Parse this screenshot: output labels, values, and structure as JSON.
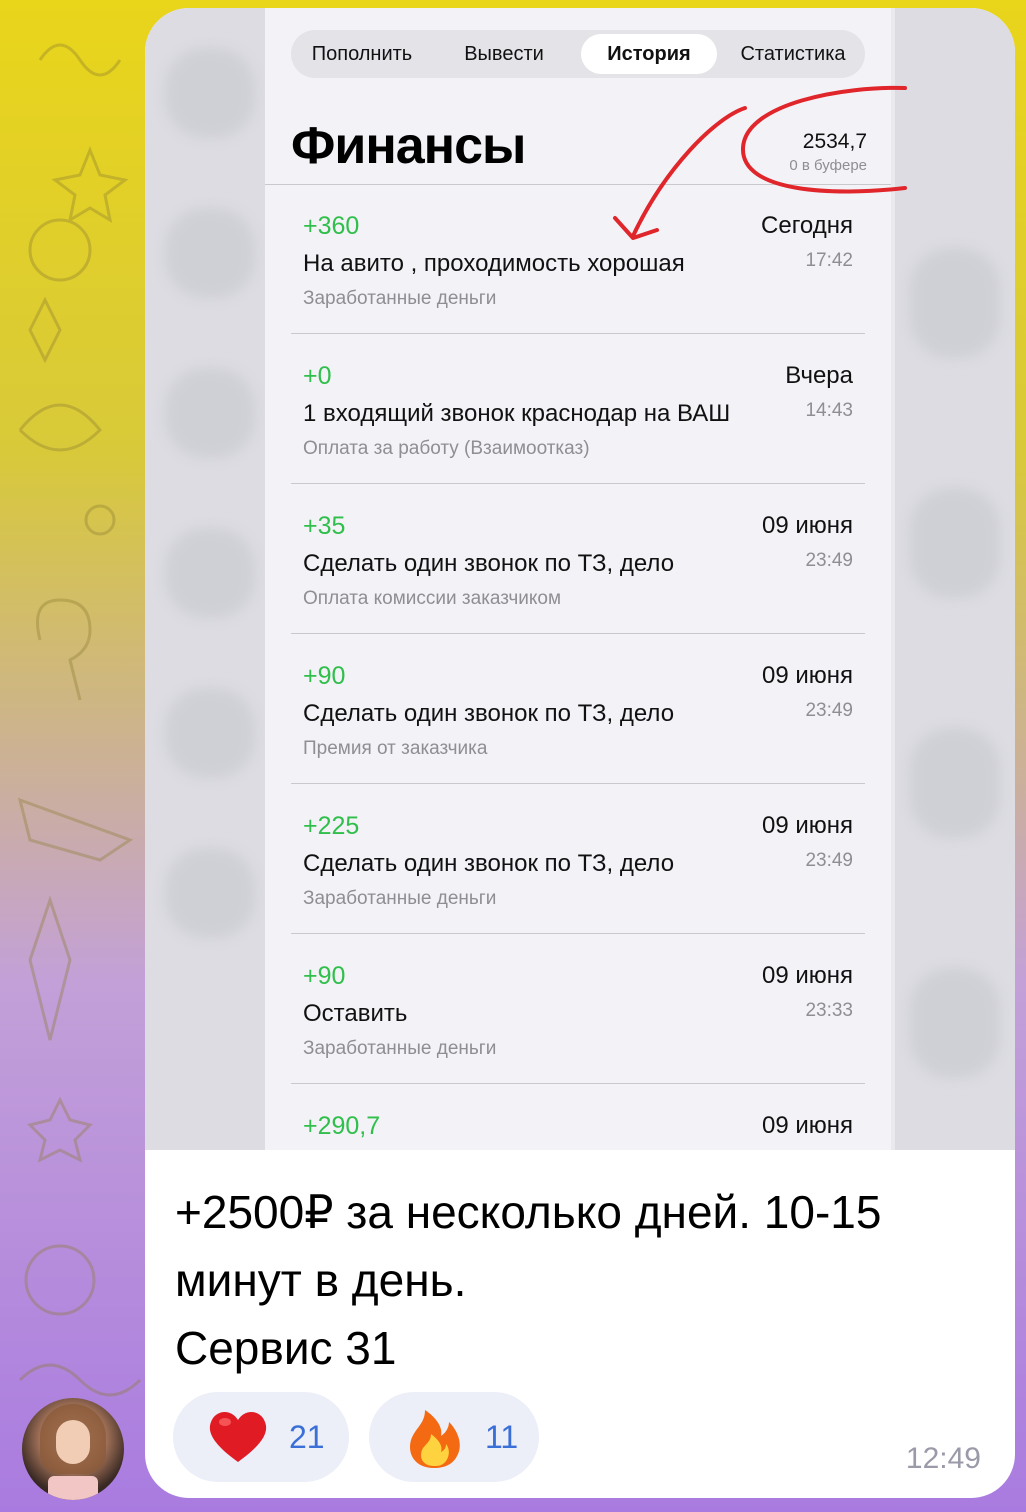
{
  "tabs": [
    {
      "label": "Пополнить",
      "active": false
    },
    {
      "label": "Вывести",
      "active": false
    },
    {
      "label": "История",
      "active": true
    },
    {
      "label": "Статистика",
      "active": false
    }
  ],
  "finance": {
    "title": "Финансы",
    "balance": "2534,7",
    "buffer": "0 в буфере"
  },
  "transactions": [
    {
      "amount": "+360",
      "desc": "На авито , проходимость хорошая",
      "category": "Заработанные деньги",
      "date": "Сегодня",
      "time": "17:42"
    },
    {
      "amount": "+0",
      "desc": "1 входящий звонок краснодар на ВАШ",
      "category": "Оплата за работу (Взаимоотказ)",
      "date": "Вчера",
      "time": "14:43"
    },
    {
      "amount": "+35",
      "desc": "Сделать один звонок по ТЗ, дело",
      "category": "Оплата комиссии заказчиком",
      "date": "09 июня",
      "time": "23:49"
    },
    {
      "amount": "+90",
      "desc": "Сделать один звонок по ТЗ, дело",
      "category": "Премия от заказчика",
      "date": "09 июня",
      "time": "23:49"
    },
    {
      "amount": "+225",
      "desc": "Сделать один звонок по ТЗ, дело",
      "category": "Заработанные деньги",
      "date": "09 июня",
      "time": "23:49"
    },
    {
      "amount": "+90",
      "desc": "Оставить",
      "category": "Заработанные деньги",
      "date": "09 июня",
      "time": "23:33"
    },
    {
      "amount": "+290,7",
      "desc": "",
      "category": "",
      "date": "09 июня",
      "time": ""
    }
  ],
  "message": {
    "line1": "+2500₽ за несколько дней. 10-15",
    "line2": "минут в день.",
    "line3": "Сервис 31",
    "time": "12:49"
  },
  "reactions": [
    {
      "emoji": "heart-icon",
      "count": "21"
    },
    {
      "emoji": "fire-icon",
      "count": "11"
    }
  ],
  "colors": {
    "positive": "#2fbf4a",
    "annotation": "#e0262b",
    "reaction_count": "#3a6fd8"
  }
}
